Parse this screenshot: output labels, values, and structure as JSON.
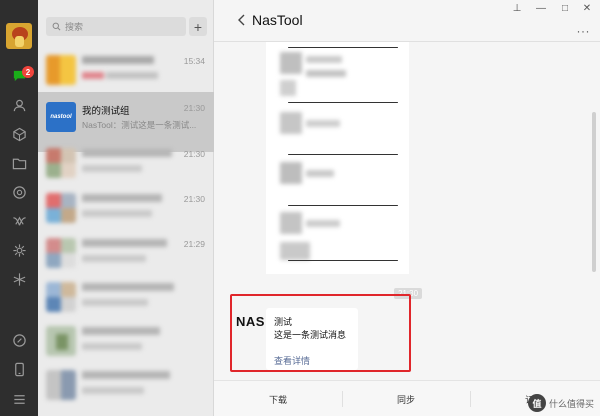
{
  "search": {
    "placeholder": "搜索"
  },
  "add_button_label": "+",
  "rail": {
    "unread_badge": "2"
  },
  "chats": [
    {
      "name": "",
      "preview": "",
      "time": "15:34"
    },
    {
      "name": "我的测试组",
      "preview": "NasTool：测试这是一条测试...",
      "time": "21:30"
    },
    {
      "name": "",
      "preview": "",
      "time": "21:30"
    },
    {
      "name": "",
      "preview": "",
      "time": "21:30"
    },
    {
      "name": "",
      "preview": "",
      "time": "21:29"
    },
    {
      "name": "",
      "preview": "",
      "time": ""
    }
  ],
  "chat_window": {
    "title": "NasTool",
    "window_controls": {
      "pin": "⊥",
      "minimize": "—",
      "maximize": "□",
      "close": "✕"
    },
    "more": "···",
    "timestamp": "21:30",
    "message": {
      "sender": "NAS",
      "title": "测试",
      "body": "这是一条测试消息",
      "link": "查看详情"
    },
    "bottom_actions": [
      "下载",
      "同步",
      "订阅"
    ]
  },
  "watermark": {
    "text": "什么值得买",
    "logo": "值"
  }
}
